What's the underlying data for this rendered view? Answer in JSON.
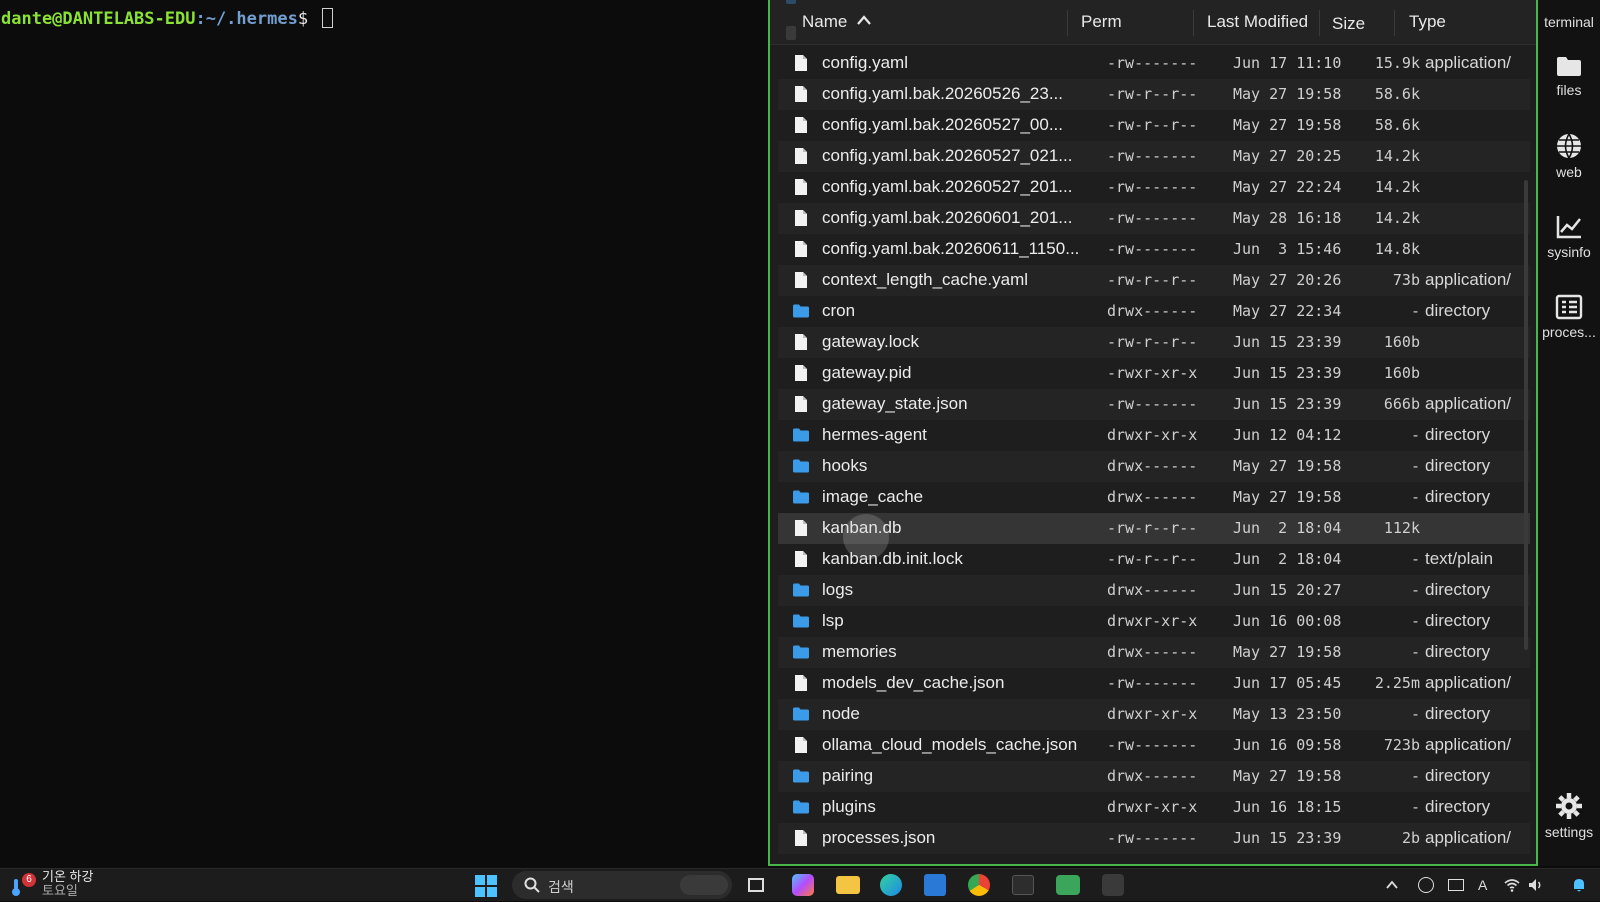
{
  "terminal": {
    "user_host": "dante@DANTELABS-EDU",
    "path": ":~/.hermes",
    "dollar": "$"
  },
  "file_panel": {
    "columns": {
      "name": "Name",
      "perm": "Perm",
      "modified": "Last Modified",
      "size": "Size",
      "type": "Type"
    },
    "sort_indicator": "^",
    "rows": [
      {
        "name": "config.yaml",
        "perm": "-rw-------",
        "modified": "Jun 17 11:10",
        "size": "15.9k",
        "type": "application/",
        "kind": "file"
      },
      {
        "name": "config.yaml.bak.20260526_23...",
        "perm": "-rw-r--r--",
        "modified": "May 27 19:58",
        "size": "58.6k",
        "type": "",
        "kind": "file"
      },
      {
        "name": "config.yaml.bak.20260527_00...",
        "perm": "-rw-r--r--",
        "modified": "May 27 19:58",
        "size": "58.6k",
        "type": "",
        "kind": "file"
      },
      {
        "name": "config.yaml.bak.20260527_021...",
        "perm": "-rw-------",
        "modified": "May 27 20:25",
        "size": "14.2k",
        "type": "",
        "kind": "file"
      },
      {
        "name": "config.yaml.bak.20260527_201...",
        "perm": "-rw-------",
        "modified": "May 27 22:24",
        "size": "14.2k",
        "type": "",
        "kind": "file"
      },
      {
        "name": "config.yaml.bak.20260601_201...",
        "perm": "-rw-------",
        "modified": "May 28 16:18",
        "size": "14.2k",
        "type": "",
        "kind": "file"
      },
      {
        "name": "config.yaml.bak.20260611_1150...",
        "perm": "-rw-------",
        "modified": "Jun  3 15:46",
        "size": "14.8k",
        "type": "",
        "kind": "file"
      },
      {
        "name": "context_length_cache.yaml",
        "perm": "-rw-r--r--",
        "modified": "May 27 20:26",
        "size": "73b",
        "type": "application/",
        "kind": "file"
      },
      {
        "name": "cron",
        "perm": "drwx------",
        "modified": "May 27 22:34",
        "size": "-",
        "type": "directory",
        "kind": "dir"
      },
      {
        "name": "gateway.lock",
        "perm": "-rw-r--r--",
        "modified": "Jun 15 23:39",
        "size": "160b",
        "type": "",
        "kind": "file"
      },
      {
        "name": "gateway.pid",
        "perm": "-rwxr-xr-x",
        "modified": "Jun 15 23:39",
        "size": "160b",
        "type": "",
        "kind": "file"
      },
      {
        "name": "gateway_state.json",
        "perm": "-rw-------",
        "modified": "Jun 15 23:39",
        "size": "666b",
        "type": "application/",
        "kind": "file"
      },
      {
        "name": "hermes-agent",
        "perm": "drwxr-xr-x",
        "modified": "Jun 12 04:12",
        "size": "-",
        "type": "directory",
        "kind": "dir"
      },
      {
        "name": "hooks",
        "perm": "drwx------",
        "modified": "May 27 19:58",
        "size": "-",
        "type": "directory",
        "kind": "dir"
      },
      {
        "name": "image_cache",
        "perm": "drwx------",
        "modified": "May 27 19:58",
        "size": "-",
        "type": "directory",
        "kind": "dir"
      },
      {
        "name": "kanban.db",
        "perm": "-rw-r--r--",
        "modified": "Jun  2 18:04",
        "size": "112k",
        "type": "",
        "kind": "file",
        "selected": true
      },
      {
        "name": "kanban.db.init.lock",
        "perm": "-rw-r--r--",
        "modified": "Jun  2 18:04",
        "size": "-",
        "type": "text/plain",
        "kind": "file"
      },
      {
        "name": "logs",
        "perm": "drwx------",
        "modified": "Jun 15 20:27",
        "size": "-",
        "type": "directory",
        "kind": "dir"
      },
      {
        "name": "lsp",
        "perm": "drwxr-xr-x",
        "modified": "Jun 16 00:08",
        "size": "-",
        "type": "directory",
        "kind": "dir"
      },
      {
        "name": "memories",
        "perm": "drwx------",
        "modified": "May 27 19:58",
        "size": "-",
        "type": "directory",
        "kind": "dir"
      },
      {
        "name": "models_dev_cache.json",
        "perm": "-rw-------",
        "modified": "Jun 17 05:45",
        "size": "2.25m",
        "type": "application/",
        "kind": "file"
      },
      {
        "name": "node",
        "perm": "drwxr-xr-x",
        "modified": "May 13 23:50",
        "size": "-",
        "type": "directory",
        "kind": "dir"
      },
      {
        "name": "ollama_cloud_models_cache.json",
        "perm": "-rw-------",
        "modified": "Jun 16 09:58",
        "size": "723b",
        "type": "application/",
        "kind": "file"
      },
      {
        "name": "pairing",
        "perm": "drwx------",
        "modified": "May 27 19:58",
        "size": "-",
        "type": "directory",
        "kind": "dir"
      },
      {
        "name": "plugins",
        "perm": "drwxr-xr-x",
        "modified": "Jun 16 18:15",
        "size": "-",
        "type": "directory",
        "kind": "dir"
      },
      {
        "name": "processes.json",
        "perm": "-rw-------",
        "modified": "Jun 15 23:39",
        "size": "2b",
        "type": "application/",
        "kind": "file"
      }
    ]
  },
  "sidebar": {
    "items": [
      {
        "label": "terminal",
        "icon": "terminal-icon"
      },
      {
        "label": "files",
        "icon": "folder-icon"
      },
      {
        "label": "web",
        "icon": "globe-icon"
      },
      {
        "label": "sysinfo",
        "icon": "chart-icon"
      },
      {
        "label": "proces...",
        "icon": "process-list-icon"
      },
      {
        "label": "settings",
        "icon": "gear-icon"
      }
    ]
  },
  "taskbar": {
    "weather_badge": "6",
    "weather_line1": "기온 하강",
    "weather_line2": "토요일",
    "search_placeholder": "검색"
  },
  "colors": {
    "panel_border": "#49b64b",
    "folder": "#3b9be8",
    "prompt_user": "#8ae234",
    "prompt_path": "#729fcf"
  }
}
